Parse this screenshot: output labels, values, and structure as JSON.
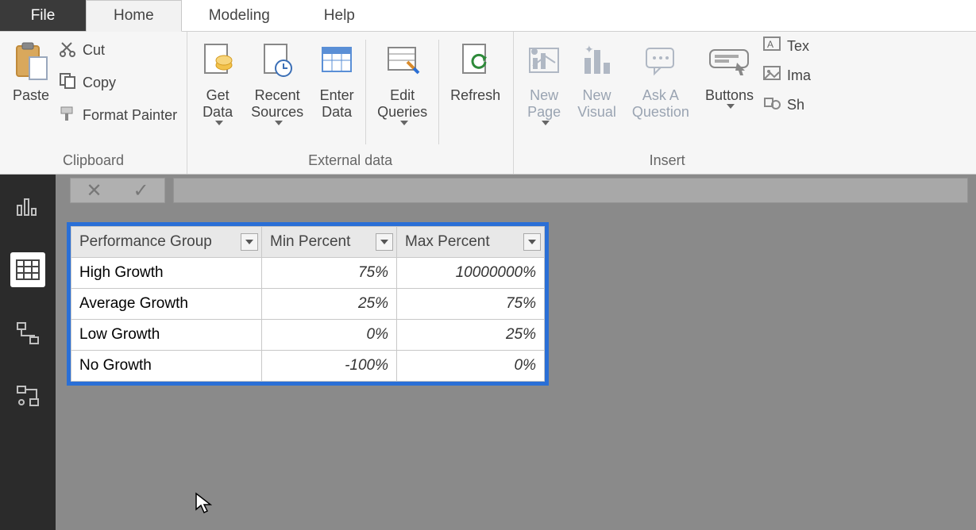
{
  "tabs": {
    "file": "File",
    "home": "Home",
    "modeling": "Modeling",
    "help": "Help"
  },
  "ribbon": {
    "clipboard": {
      "label": "Clipboard",
      "paste": "Paste",
      "cut": "Cut",
      "copy": "Copy",
      "format_painter": "Format Painter"
    },
    "external_data": {
      "label": "External data",
      "get_data": "Get\nData",
      "recent_sources": "Recent\nSources",
      "enter_data": "Enter\nData",
      "edit_queries": "Edit\nQueries",
      "refresh": "Refresh"
    },
    "insert": {
      "label": "Insert",
      "new_page": "New\nPage",
      "new_visual": "New\nVisual",
      "ask_a_question": "Ask A\nQuestion",
      "buttons": "Buttons",
      "text": "Tex",
      "image": "Ima",
      "shapes": "Sh"
    }
  },
  "formula_bar": {
    "value": ""
  },
  "table": {
    "columns": {
      "c1": "Performance Group",
      "c2": "Min Percent",
      "c3": "Max Percent"
    },
    "rows": [
      {
        "group": "High Growth",
        "min": "75%",
        "max": "10000000%"
      },
      {
        "group": "Average Growth",
        "min": "25%",
        "max": "75%"
      },
      {
        "group": "Low Growth",
        "min": "0%",
        "max": "25%"
      },
      {
        "group": "No Growth",
        "min": "-100%",
        "max": "0%"
      }
    ]
  }
}
